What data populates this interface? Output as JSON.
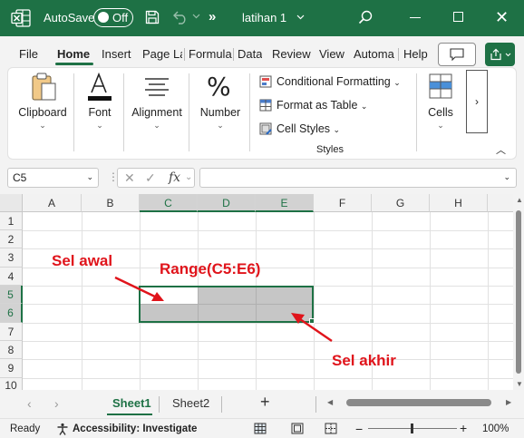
{
  "titlebar": {
    "autosave_label": "AutoSave",
    "autosave_state": "Off",
    "more_label": "»",
    "doc_title": "latihan 1",
    "brand_color": "#1e7145"
  },
  "menu": {
    "tabs": [
      "File",
      "Home",
      "Insert",
      "Page La",
      "Formula",
      "Data",
      "Review",
      "View",
      "Automa",
      "Help"
    ],
    "active_tab": "Home"
  },
  "ribbon": {
    "groups": {
      "clipboard": "Clipboard",
      "font": "Font",
      "alignment": "Alignment",
      "number": "Number",
      "cells": "Cells"
    },
    "number_symbol": "%",
    "styles": {
      "conditional_formatting": "Conditional Formatting",
      "format_as_table": "Format as Table",
      "cell_styles": "Cell Styles",
      "group_label": "Styles"
    },
    "scroll_label": "›"
  },
  "formula_bar": {
    "name_box": "C5",
    "fx_label": "fx",
    "formula": ""
  },
  "grid": {
    "columns": [
      "A",
      "B",
      "C",
      "D",
      "E",
      "F",
      "G",
      "H"
    ],
    "selected_columns": [
      "C",
      "D",
      "E"
    ],
    "rows": [
      "1",
      "2",
      "3",
      "4",
      "5",
      "6",
      "7",
      "8",
      "9",
      "10"
    ],
    "selected_rows": [
      "5",
      "6"
    ],
    "active_cell": "C5",
    "selected_range": "C5:E6"
  },
  "annotations": {
    "start_cell": "Sel awal",
    "range": "Range(C5:E6)",
    "end_cell": "Sel akhir",
    "color": "#e0141b"
  },
  "sheets": {
    "tabs": [
      "Sheet1",
      "Sheet2"
    ],
    "active": "Sheet1",
    "add_label": "+"
  },
  "status": {
    "ready": "Ready",
    "accessibility": "Accessibility: Investigate",
    "zoom": "100%"
  }
}
